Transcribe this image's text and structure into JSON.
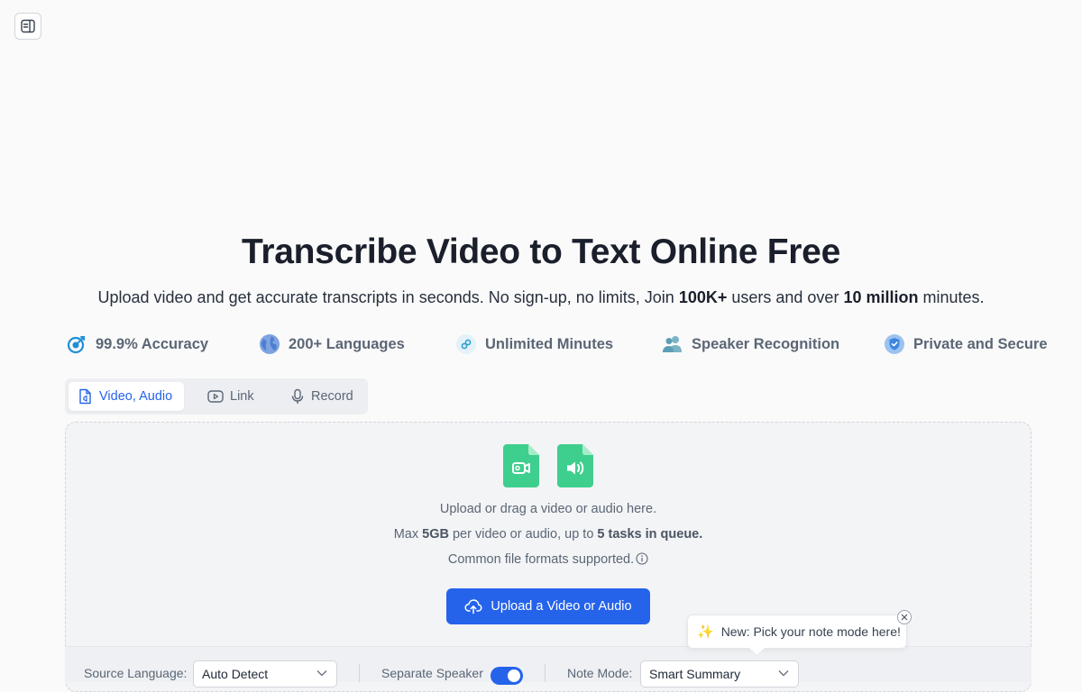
{
  "hero": {
    "title": "Transcribe Video to Text Online Free",
    "sub_part1": "Upload video and get accurate transcripts in seconds. No sign-up, no limits, Join ",
    "sub_bold1": "100K+",
    "sub_part2": " users and over ",
    "sub_bold2": "10 million",
    "sub_part3": " minutes."
  },
  "features": [
    {
      "label": "99.9% Accuracy",
      "icon": "target-icon"
    },
    {
      "label": "200+ Languages",
      "icon": "globe-icon"
    },
    {
      "label": "Unlimited Minutes",
      "icon": "infinity-link-icon"
    },
    {
      "label": "Speaker Recognition",
      "icon": "users-icon"
    },
    {
      "label": "Private and Secure",
      "icon": "shield-check-icon"
    }
  ],
  "tabs": [
    {
      "label": "Video, Audio",
      "icon": "file-audio-icon",
      "active": true
    },
    {
      "label": "Link",
      "icon": "youtube-icon",
      "active": false
    },
    {
      "label": "Record",
      "icon": "microphone-icon",
      "active": false
    }
  ],
  "dropzone": {
    "line1": "Upload or drag a video or audio here.",
    "line2_a": "Max ",
    "line2_b": "5GB",
    "line2_c": " per video or audio, up to ",
    "line2_d": "5 tasks in queue.",
    "line3": "Common file formats supported.",
    "upload_button": "Upload a Video or Audio"
  },
  "options": {
    "source_language_label": "Source Language:",
    "source_language_value": "Auto Detect",
    "separate_speaker_label": "Separate Speaker",
    "separate_speaker_on": true,
    "note_mode_label": "Note Mode:",
    "note_mode_value": "Smart Summary"
  },
  "tooltip": {
    "text": "New: Pick your note mode here!",
    "icon": "sparkles-icon"
  },
  "colors": {
    "accent": "#2563eb",
    "file_green": "#3ecf8e"
  }
}
